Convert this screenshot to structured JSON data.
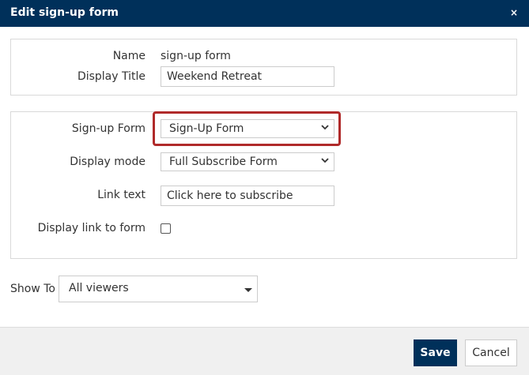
{
  "dialog": {
    "title": "Edit sign-up form",
    "close_glyph": "×"
  },
  "basic": {
    "name_label": "Name",
    "name_value": "sign-up form",
    "display_title_label": "Display Title",
    "display_title_value": "Weekend Retreat"
  },
  "settings": {
    "signup_form_label": "Sign-up Form",
    "signup_form_value": "Sign-Up Form",
    "display_mode_label": "Display mode",
    "display_mode_value": "Full Subscribe Form",
    "link_text_label": "Link text",
    "link_text_value": "Click here to subscribe",
    "display_link_label": "Display link to form",
    "display_link_checked": false
  },
  "show_to": {
    "label": "Show To",
    "value": "All viewers"
  },
  "footer": {
    "save_label": "Save",
    "cancel_label": "Cancel"
  },
  "colors": {
    "header_bg": "#00305a",
    "highlight": "#b02a2a",
    "footer_bg": "#f0f0f0"
  }
}
